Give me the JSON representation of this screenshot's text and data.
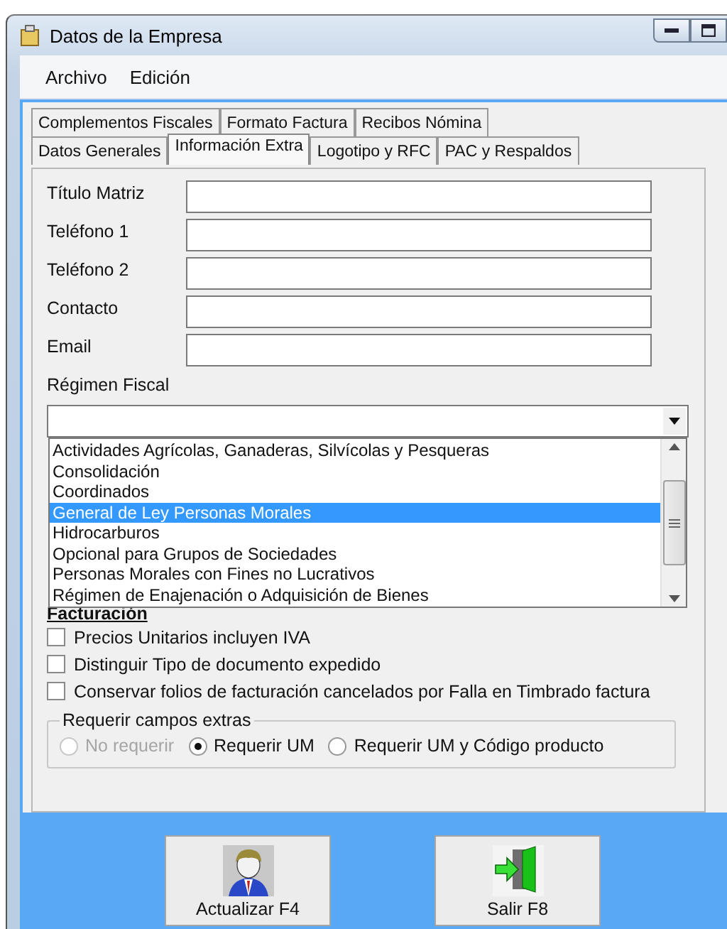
{
  "window": {
    "title": "Datos de la Empresa"
  },
  "menu": [
    "Archivo",
    "Edición"
  ],
  "tabs": {
    "rows": [
      [
        {
          "label": "Complementos Fiscales",
          "selected": false
        },
        {
          "label": "Formato Factura",
          "selected": false
        },
        {
          "label": "Recibos Nómina",
          "selected": false
        }
      ],
      [
        {
          "label": "Datos Generales",
          "selected": false
        },
        {
          "label": "Información Extra",
          "selected": true
        },
        {
          "label": "Logotipo y RFC",
          "selected": false
        },
        {
          "label": "PAC y Respaldos",
          "selected": false
        }
      ]
    ]
  },
  "fields": [
    {
      "label": "Título Matriz"
    },
    {
      "label": "Teléfono 1"
    },
    {
      "label": "Teléfono 2"
    },
    {
      "label": "Contacto"
    },
    {
      "label": "Email"
    }
  ],
  "regimen_fiscal": {
    "label": "Régimen Fiscal",
    "expanded": true,
    "options": [
      {
        "label": "Actividades Agrícolas, Ganaderas, Silvícolas y Pesqueras",
        "selected": false
      },
      {
        "label": "Consolidación",
        "selected": false
      },
      {
        "label": "Coordinados",
        "selected": false
      },
      {
        "label": "General de Ley Personas Morales",
        "selected": true
      },
      {
        "label": "Hidrocarburos",
        "selected": false
      },
      {
        "label": "Opcional para Grupos de Sociedades",
        "selected": false
      },
      {
        "label": "Personas Morales con Fines no Lucrativos",
        "selected": false
      },
      {
        "label": "Régimen de Enajenación o Adquisición de Bienes",
        "selected": false
      }
    ]
  },
  "facturacion": {
    "title": "Facturación",
    "options": [
      {
        "label": "Precios Unitarios incluyen IVA",
        "checked": false
      },
      {
        "label": "Distinguir Tipo de documento expedido",
        "checked": false
      },
      {
        "label": "Conservar folios de facturación cancelados por Falla en Timbrado factura",
        "checked": false
      }
    ]
  },
  "requerir_campos_extras": {
    "title": "Requerir campos extras",
    "options": [
      {
        "label": "No requerir",
        "selected": false,
        "disabled": true
      },
      {
        "label": "Requerir UM",
        "selected": true,
        "disabled": false
      },
      {
        "label": "Requerir UM y Código producto",
        "selected": false,
        "disabled": false
      }
    ]
  },
  "buttons": [
    {
      "label": "Actualizar F4",
      "kind": "person"
    },
    {
      "label": "Salir F8",
      "kind": "exit"
    }
  ]
}
